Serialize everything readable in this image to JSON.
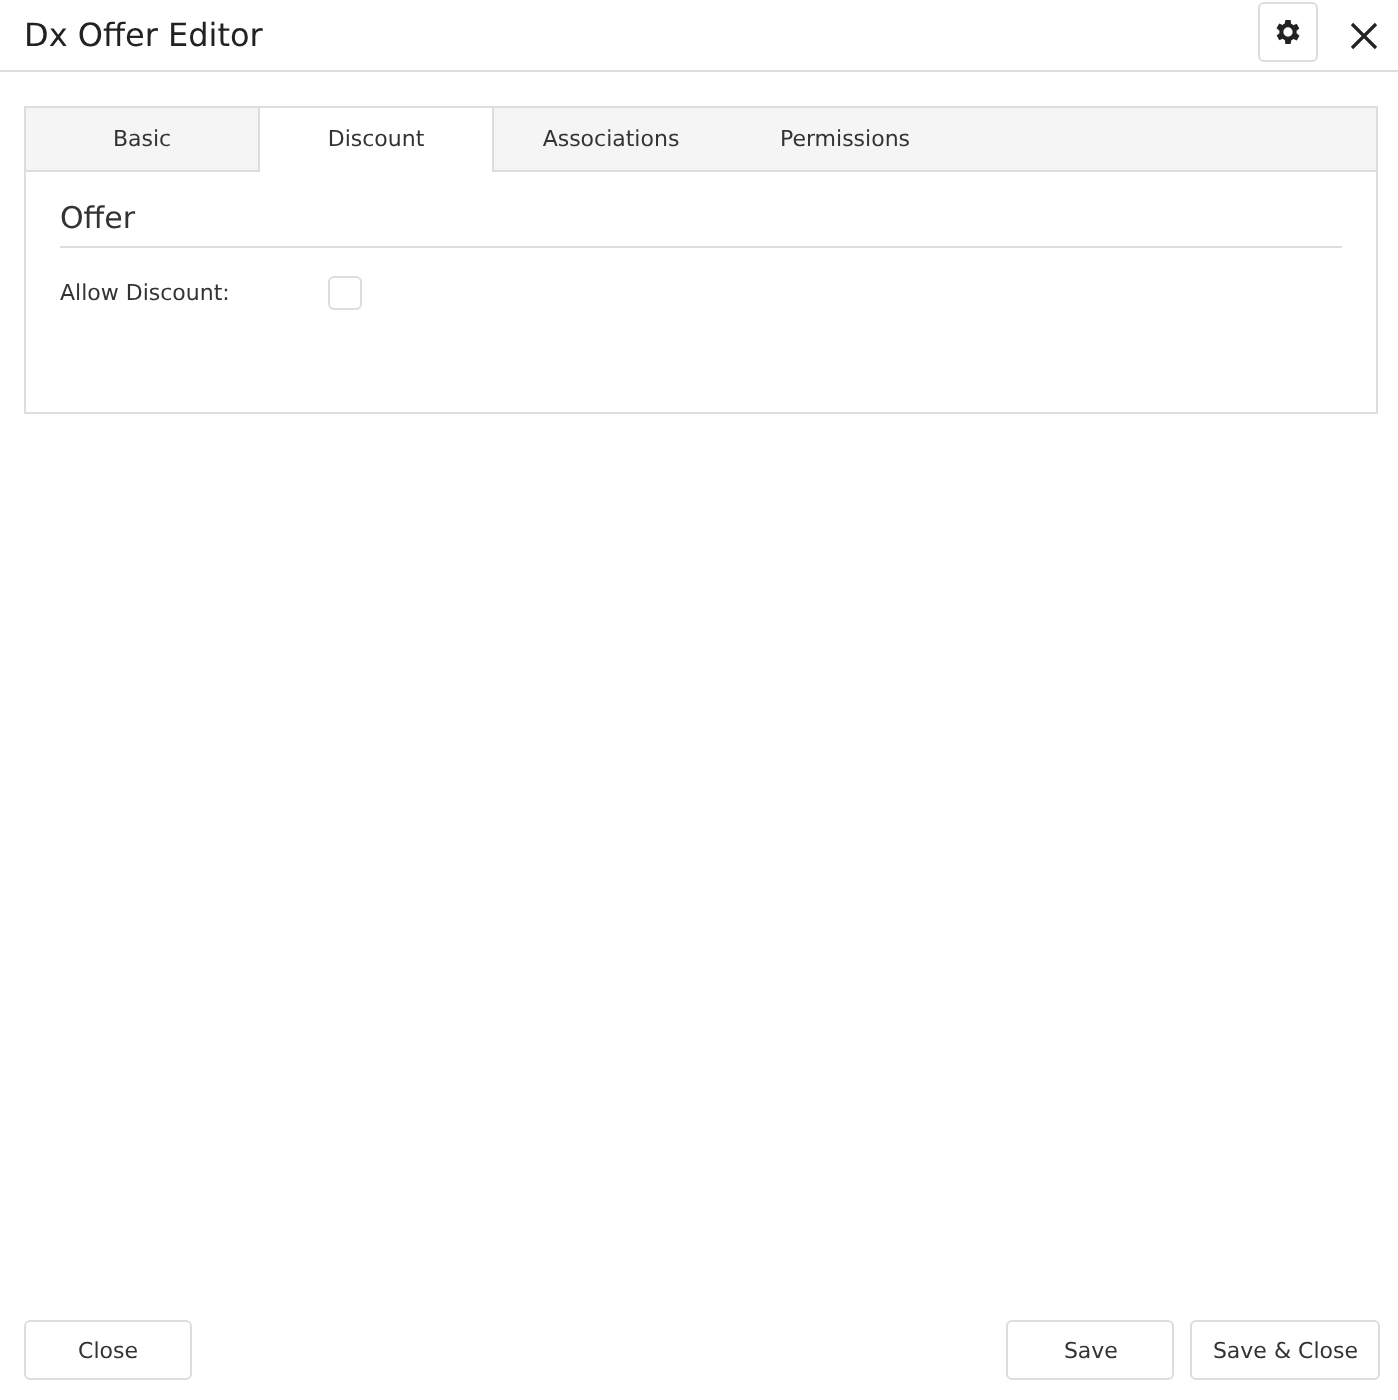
{
  "window": {
    "title": "Dx Offer Editor"
  },
  "tabs": [
    {
      "label": "Basic",
      "selected": false
    },
    {
      "label": "Discount",
      "selected": true
    },
    {
      "label": "Associations",
      "selected": false
    },
    {
      "label": "Permissions",
      "selected": false
    }
  ],
  "section": {
    "title": "Offer",
    "fields": [
      {
        "label": "Allow Discount:",
        "checked": false
      }
    ]
  },
  "footer": {
    "left_buttons": [
      "Close"
    ],
    "right_buttons": [
      "Save",
      "Save & Close"
    ]
  }
}
